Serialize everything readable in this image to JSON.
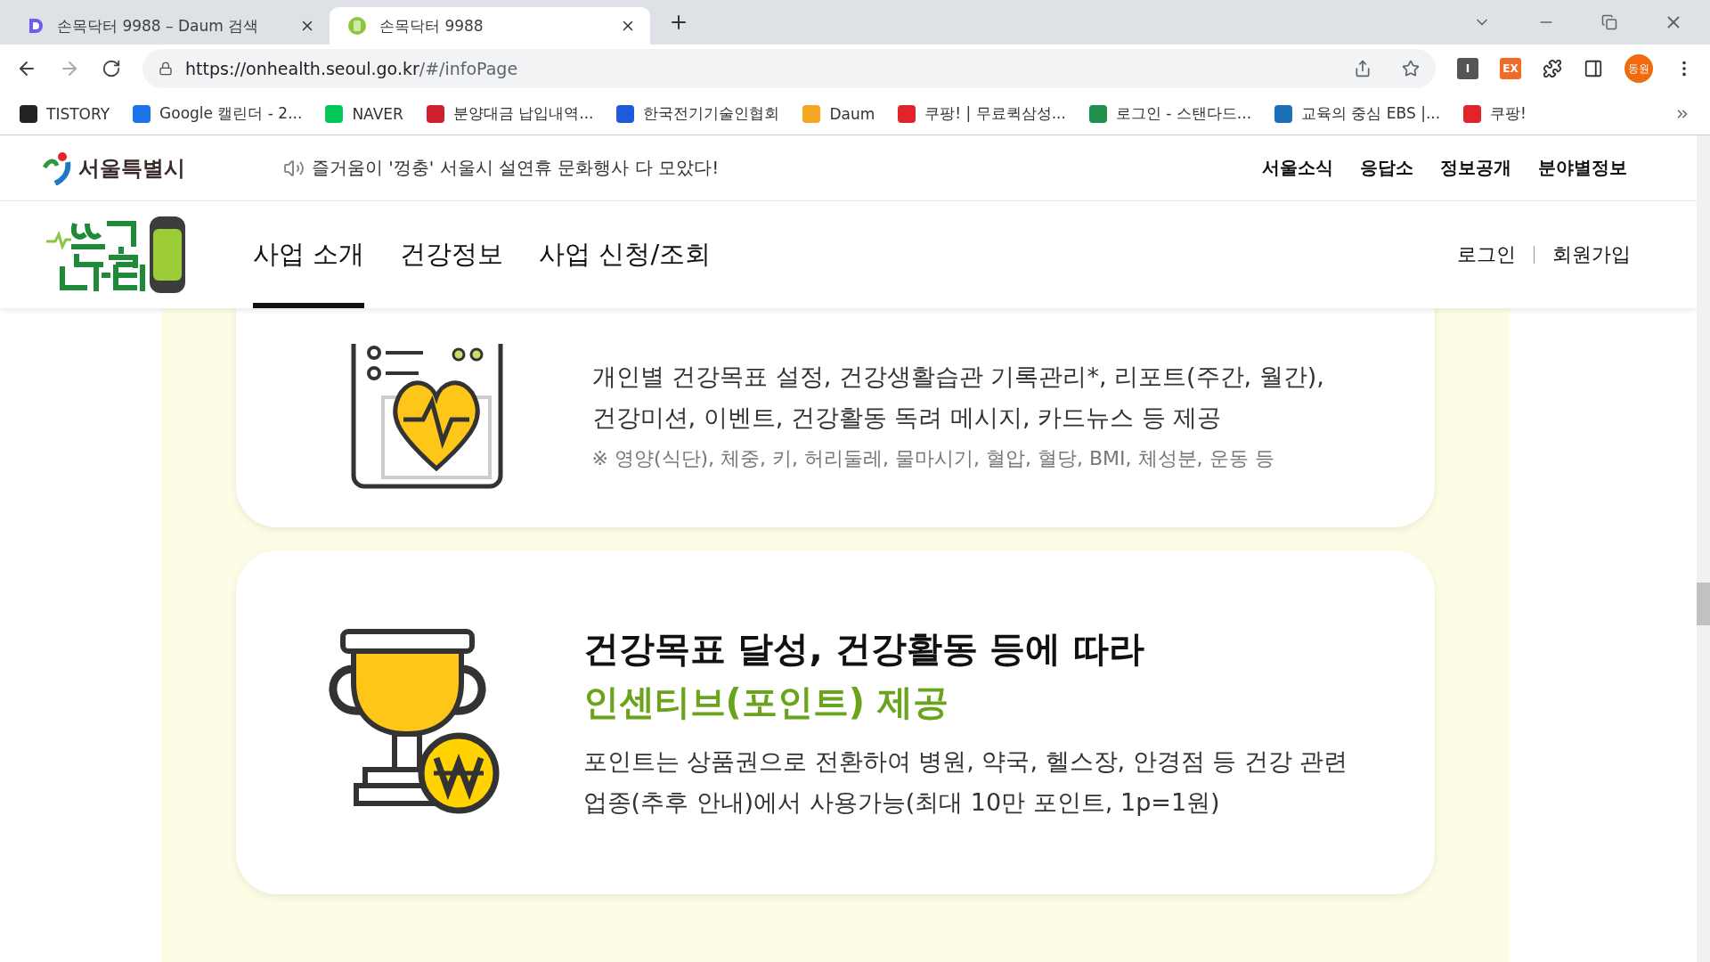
{
  "browser": {
    "tabs": [
      {
        "title": "손목닥터 9988 – Daum 검색",
        "selected": false,
        "kind": "daum"
      },
      {
        "title": "손목닥터 9988",
        "selected": true,
        "kind": "watch"
      }
    ],
    "url_host": "https://onhealth.seoul.go.kr",
    "url_path": "/#/infoPage",
    "extensions": [
      "I",
      "EX"
    ],
    "profile": "동원",
    "bookmarks": [
      {
        "label": "TISTORY",
        "color": "#222222"
      },
      {
        "label": "Google 캘린더 - 2...",
        "color": "#1a73e8"
      },
      {
        "label": "NAVER",
        "color": "#03c75a"
      },
      {
        "label": "분양대금 납입내역...",
        "color": "#d0202f"
      },
      {
        "label": "한국전기기술인협회",
        "color": "#1e5bd8"
      },
      {
        "label": "Daum",
        "color": "#f5a623"
      },
      {
        "label": "쿠팡! | 무료퀵삼성...",
        "color": "#e0242b"
      },
      {
        "label": "로그인 - 스탠다드...",
        "color": "#1f8f4e"
      },
      {
        "label": "교육의 중심 EBS |...",
        "color": "#1d6fb8"
      },
      {
        "label": "쿠팡!",
        "color": "#e0242b"
      }
    ]
  },
  "site": {
    "city": "서울특별시",
    "notice": "즐거움이 '껑충' 서울시 설연휴 문화행사 다 모았다!",
    "top_links": [
      "서울소식",
      "응답소",
      "정보공개",
      "분야별정보"
    ],
    "nav": [
      {
        "label": "사업 소개",
        "selected": true
      },
      {
        "label": "건강정보",
        "selected": false
      },
      {
        "label": "사업 신청/조회",
        "selected": false
      }
    ],
    "auth": [
      "로그인",
      "회원가입"
    ]
  },
  "cards": [
    {
      "kind": "health",
      "description": "개인별 건강목표 설정, 건강생활습관 기록관리*, 리포트(주간, 월간),\n건강미션, 이벤트, 건강활동 독려 메시지, 카드뉴스 등 제공",
      "note": "※ 영양(식단), 체중, 키, 허리둘레, 물마시기, 혈압, 혈당, BMI, 체성분, 운동 등"
    },
    {
      "kind": "trophy",
      "title": [
        {
          "text": "건강목표 달성, 건강활동 등에 따라",
          "emphasis": false
        },
        {
          "text": "인센티브(포인트) 제공",
          "emphasis": true
        }
      ],
      "description": "포인트는 상품권으로 전환하여 병원, 약국, 헬스장, 안경점 등 건강 관련\n업종(추후 안내)에서 사용가능(최대 10만 포인트, 1p=1원)"
    }
  ]
}
